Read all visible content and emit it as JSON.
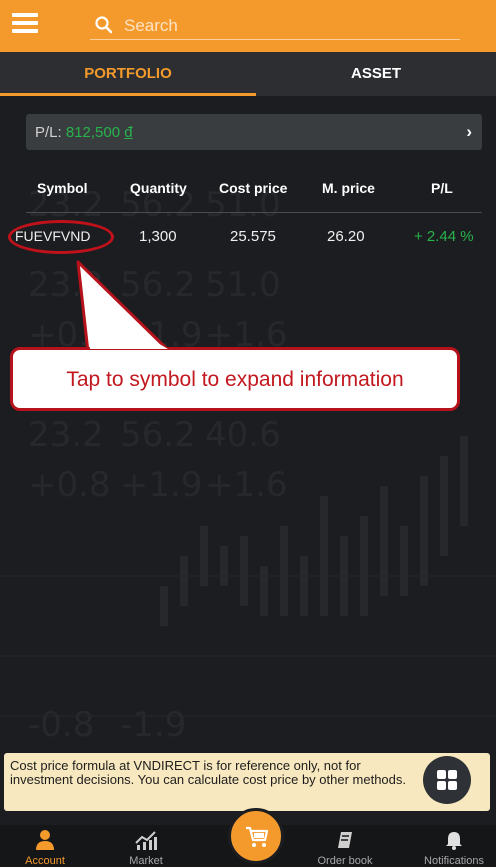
{
  "header": {
    "search_placeholder": "Search"
  },
  "tabs": [
    {
      "label": "PORTFOLIO",
      "active": true
    },
    {
      "label": "ASSET",
      "active": false
    }
  ],
  "pl_summary": {
    "label": "P/L:",
    "value": "812,500",
    "currency": "đ"
  },
  "table": {
    "headers": [
      "Symbol",
      "Quantity",
      "Cost price",
      "M. price",
      "P/L"
    ],
    "rows": [
      {
        "symbol": "FUEVFVND",
        "quantity": "1,300",
        "cost_price": "25.575",
        "market_price": "26.20",
        "pl": "+ 2.44 %"
      }
    ]
  },
  "annotation": {
    "callout_text": "Tap to symbol to expand information"
  },
  "disclaimer": {
    "text": "Cost price formula at VNDIRECT is for reference only, not for investment decisions. You can calculate cost price by other methods."
  },
  "bottom_nav": [
    {
      "label": "Account",
      "icon": "person-icon",
      "active": true
    },
    {
      "label": "Market",
      "icon": "chart-icon",
      "active": false
    },
    {
      "label": "",
      "icon": "cart-icon",
      "active": false
    },
    {
      "label": "Order book",
      "icon": "book-icon",
      "active": false
    },
    {
      "label": "Notifications",
      "icon": "bell-icon",
      "active": false
    }
  ],
  "colors": {
    "accent": "#f49a2c",
    "positive": "#28b34b",
    "annotation_red": "#c1121c",
    "background": "#1b1d20"
  }
}
